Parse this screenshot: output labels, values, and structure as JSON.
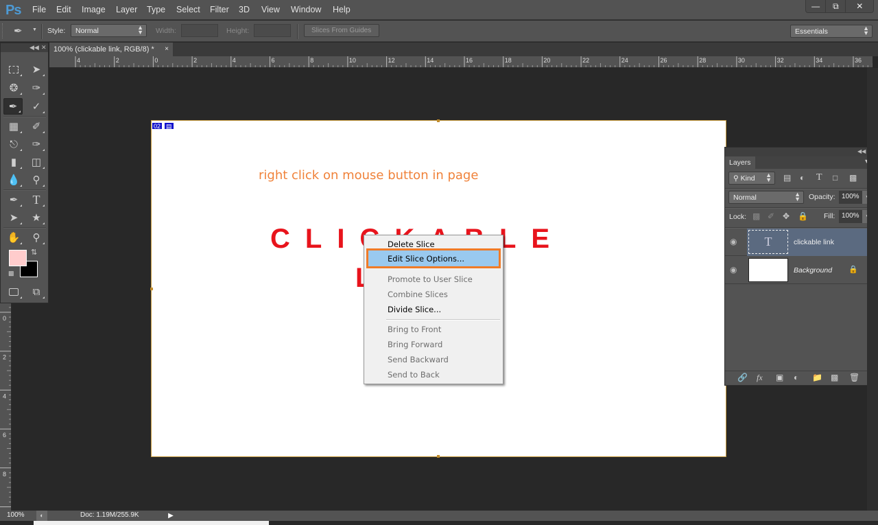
{
  "app": {
    "logo": "Ps"
  },
  "menu": [
    "File",
    "Edit",
    "Image",
    "Layer",
    "Type",
    "Select",
    "Filter",
    "3D",
    "View",
    "Window",
    "Help"
  ],
  "window_controls": {
    "minimize": "minimize-icon",
    "restore": "restore-icon",
    "close": "close-icon"
  },
  "options_bar": {
    "style_label": "Style:",
    "style_value": "Normal",
    "width_label": "Width:",
    "height_label": "Height:",
    "slices_button": "Slices From Guides",
    "workspace": "Essentials"
  },
  "document_tab": {
    "title": "100% (clickable link, RGB/8) *",
    "close": "×"
  },
  "ruler": {
    "horizontal": [
      "4",
      "2",
      "0",
      "2",
      "4",
      "6",
      "8",
      "10",
      "12",
      "14",
      "16",
      "18",
      "20",
      "22",
      "24",
      "26",
      "28",
      "30",
      "32",
      "34",
      "36"
    ],
    "vertical": [
      "0",
      "2",
      "4",
      "6",
      "8"
    ]
  },
  "toolbox": {
    "tools": [
      "rectangular-marquee",
      "move",
      "lasso",
      "quick-selection",
      "slice",
      "eyedropper",
      "spot-healing",
      "brush",
      "clone-stamp",
      "history-brush",
      "eraser",
      "paint-bucket",
      "blur",
      "dodge",
      "pen",
      "type",
      "path-selection",
      "custom-shape",
      "hand",
      "zoom",
      "quick-mask",
      "screen-mode"
    ],
    "foreground_color": "#ffcccc",
    "background_color": "#000000"
  },
  "canvas": {
    "slice_number": "02",
    "instruction": "right click on mouse button in page",
    "heading_line1": "CLICKABLE",
    "heading_line2": "L",
    "instruction_color": "#f0823a",
    "heading_color": "#e8141c"
  },
  "context_menu": {
    "items": [
      {
        "label": "Delete Slice",
        "enabled": true
      },
      {
        "label": "Edit Slice Options...",
        "enabled": true,
        "highlighted": true
      },
      {
        "label": "Promote to User Slice",
        "enabled": false
      },
      {
        "label": "Combine Slices",
        "enabled": false
      },
      {
        "label": "Divide Slice...",
        "enabled": true
      },
      {
        "label": "Bring to Front",
        "enabled": false
      },
      {
        "label": "Bring Forward",
        "enabled": false
      },
      {
        "label": "Send Backward",
        "enabled": false
      },
      {
        "label": "Send to Back",
        "enabled": false
      }
    ],
    "highlight_border_color": "#f07b27"
  },
  "layers_panel": {
    "tab": "Layers",
    "filter": "Kind",
    "blend_mode": "Normal",
    "opacity_label": "Opacity:",
    "opacity": "100%",
    "lock_label": "Lock:",
    "fill_label": "Fill:",
    "fill": "100%",
    "layers": [
      {
        "name": "clickable link",
        "type": "text",
        "selected": true,
        "visible": true
      },
      {
        "name": "Background",
        "type": "pixel",
        "locked": true,
        "visible": true
      }
    ]
  },
  "status_bar": {
    "zoom": "100%",
    "doc": "Doc: 1.19M/255.9K"
  }
}
